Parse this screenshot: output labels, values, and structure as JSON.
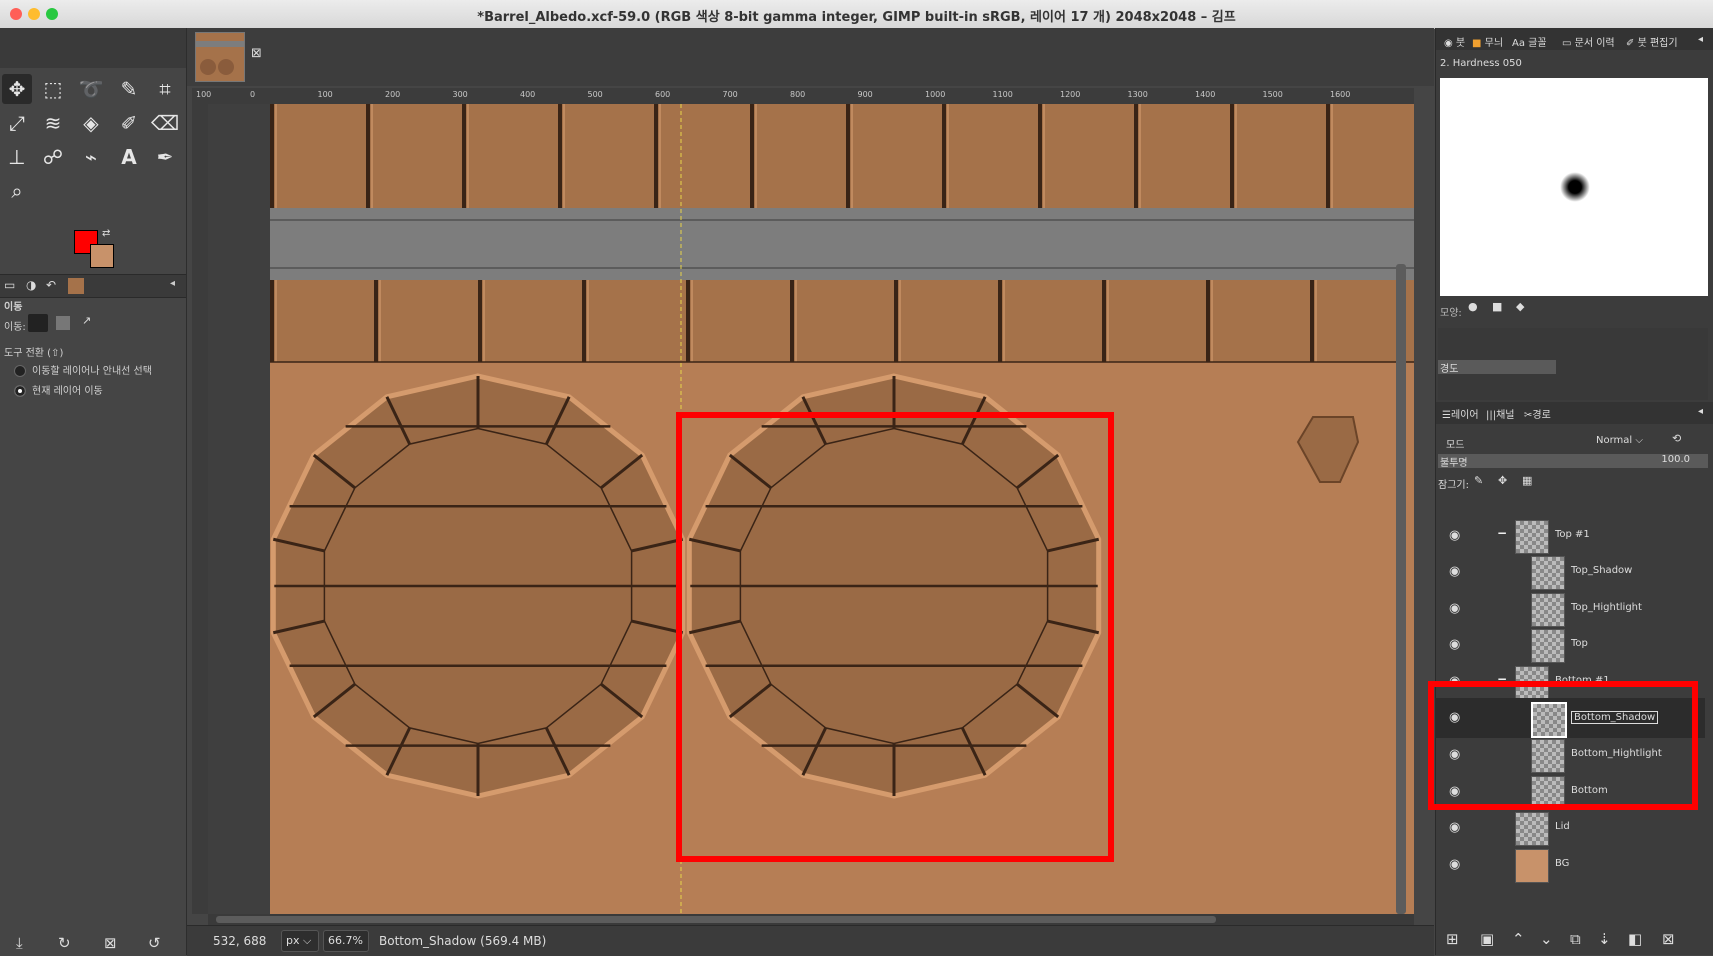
{
  "window": {
    "title": "*Barrel_Albedo.xcf-59.0 (RGB 색상 8-bit gamma integer, GIMP built-in sRGB, 레이어 17 개) 2048x2048 – 김프"
  },
  "toolbox": {
    "tool_options_header": "이동",
    "move_label": "이동:",
    "tool_toggle_label": "도구 전환  (⇧)",
    "option_pick": "이동할 레이어나 안내선 선택",
    "option_active": "현재 레이어 이동"
  },
  "ruler": {
    "h_labels": [
      "100",
      "0",
      "100",
      "200",
      "300",
      "400",
      "500",
      "600",
      "700",
      "800",
      "900",
      "1000",
      "1100",
      "1200",
      "1300",
      "1400",
      "1500",
      "1600"
    ]
  },
  "statusbar": {
    "coords": "532, 688",
    "unit": "px",
    "zoom": "66.7%",
    "layer_info": "Bottom_Shadow (569.4 MB)"
  },
  "dock": {
    "tabs": [
      "붓",
      "무늬",
      "글꼴",
      "문서 이력",
      "붓 편집기"
    ],
    "brush_name": "2. Hardness 050",
    "shape_label": "모양:",
    "hardness_label": "경도",
    "layers_tabs": [
      "레이어",
      "채널",
      "경로"
    ],
    "mode_label": "모드",
    "mode_value": "Normal",
    "opacity_label": "불투명",
    "opacity_value": "100.0",
    "lock_label": "잠그기:"
  },
  "layers": [
    {
      "name": "Top #1",
      "group": true
    },
    {
      "name": "Top_Shadow"
    },
    {
      "name": "Top_Hightlight"
    },
    {
      "name": "Top"
    },
    {
      "name": "Bottom #1",
      "group": true
    },
    {
      "name": "Bottom_Shadow",
      "selected": true
    },
    {
      "name": "Bottom_Hightlight"
    },
    {
      "name": "Bottom"
    },
    {
      "name": "Lid"
    },
    {
      "name": "BG"
    }
  ],
  "colors": {
    "fg": "#ff0000",
    "bg": "#c8926a",
    "wood": "#a5724a",
    "wood_bg": "#b67e55",
    "metal": "#7d7d7d",
    "highlight_box": "#ff0000"
  }
}
